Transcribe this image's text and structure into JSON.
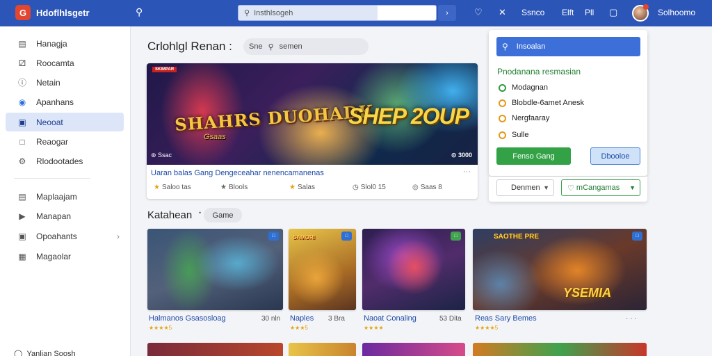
{
  "topbar": {
    "logo_letter": "G",
    "app_title": "Hdoflhlsgetr",
    "search_placeholder": "Insthlsogeh",
    "icons": [
      "search-icon",
      "heart-icon",
      "close-icon",
      "circle-icon"
    ],
    "links": [
      "Ssnco",
      "Elft",
      "Pll"
    ],
    "user_name": "Solhoomo"
  },
  "sidebar": {
    "items": [
      {
        "label": "Hanagja",
        "icon": "page-icon"
      },
      {
        "label": "Roocamta",
        "icon": "dice-icon"
      },
      {
        "label": "Netain",
        "icon": "info-icon"
      },
      {
        "label": "Apanhans",
        "icon": "compass-icon"
      },
      {
        "label": "Neooat",
        "icon": "folder-icon",
        "active": true
      },
      {
        "label": "Reaogar",
        "icon": "chat-icon"
      },
      {
        "label": "Rlodootades",
        "icon": "gear-icon"
      },
      {
        "label": "Maplaajam",
        "icon": "doc-icon"
      },
      {
        "label": "Manapan",
        "icon": "tag-icon"
      },
      {
        "label": "Opoahants",
        "icon": "box-icon",
        "has_chevron": true
      },
      {
        "label": "Magaolar",
        "icon": "grid-icon"
      }
    ],
    "bottom_label": "Yanlian Soosh"
  },
  "main": {
    "page_title": "Crlohlgl Renan :",
    "head_search": {
      "left": "Sne",
      "placeholder": "semen"
    },
    "hero": {
      "tag": "SKIMPAR",
      "art_title": "SHAHRS DUOHADK",
      "art_subtitle": "Gsaas",
      "art_logo": "SHEP 2OUP",
      "corner_left": "⊛ Ssac",
      "corner_right": "⊙ 3000",
      "caption": "Uaran balas Gang Dengeceahar nenencamanenas",
      "stats": [
        "Saloo tas",
        "Blools",
        "Salas",
        "Slol0 15",
        "Saas 8"
      ]
    },
    "section": {
      "title": "Katahean",
      "chip": "Game"
    },
    "cards": [
      {
        "title": "Halmanos Gsasosloag",
        "meta": "30 nln",
        "stars": "★★★★5"
      },
      {
        "title": "Naples",
        "meta": "3 Bra",
        "stars": "★★★5"
      },
      {
        "title": "Naoat Conaling",
        "meta": "53 Dita",
        "stars": "★★★★"
      },
      {
        "title": "Reas Sary Bemes",
        "meta": "· · ·",
        "stars": "★★★★5"
      }
    ],
    "card_art": {
      "c2": "SAMORI",
      "c4_big": "YSEMIA",
      "c4_small": "SAOTHE PRE"
    }
  },
  "popup": {
    "search_text": "Insoalan",
    "title": "Pnodanana resmasian",
    "options": [
      {
        "label": "Modagnan",
        "color": "#2f9b3e"
      },
      {
        "label": "Blobdle-6amet Anesk",
        "color": "#e39a1b"
      },
      {
        "label": "Nergfaaray",
        "color": "#e39a1b"
      },
      {
        "label": "Sulle",
        "color": "#e39a1b"
      }
    ],
    "btn_primary": "Fenso Gang",
    "btn_secondary": "Dbooloe",
    "filter_left": "Denmen",
    "filter_right": "mCangamas"
  }
}
